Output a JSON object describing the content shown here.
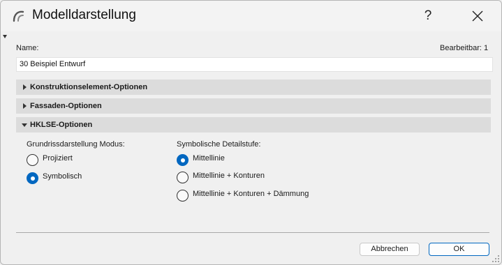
{
  "window": {
    "title": "Modelldarstellung",
    "help_label": "?",
    "icon": "archicad-arc-icon"
  },
  "name_field": {
    "label": "Name:",
    "value": "30 Beispiel Entwurf",
    "editable_label": "Bearbeitbar: 1"
  },
  "sections": [
    {
      "label": "Konstruktionselement-Optionen",
      "expanded": false
    },
    {
      "label": "Fassaden-Optionen",
      "expanded": false
    },
    {
      "label": "HKLSE-Optionen",
      "expanded": true
    }
  ],
  "floorplan_mode": {
    "label": "Grundrissdarstellung Modus:",
    "options": [
      {
        "label": "Projiziert",
        "selected": false
      },
      {
        "label": "Symbolisch",
        "selected": true
      }
    ]
  },
  "detail_level": {
    "label": "Symbolische Detailstufe:",
    "options": [
      {
        "label": "Mittellinie",
        "selected": true
      },
      {
        "label": "Mittellinie + Konturen",
        "selected": false
      },
      {
        "label": "Mittellinie + Konturen + Dämmung",
        "selected": false
      }
    ]
  },
  "footer": {
    "cancel_label": "Abbrechen",
    "ok_label": "OK"
  },
  "colors": {
    "accent": "#0067c0",
    "section_bg": "#dcdcdc",
    "dialog_bg": "#f0f0f0"
  }
}
